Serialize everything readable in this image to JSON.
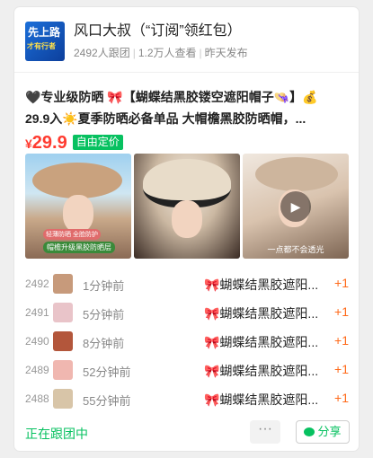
{
  "group": {
    "avatar_line1": "先上路",
    "avatar_line2": "才有行者",
    "avatar_line3": "",
    "name": "风口大叔（“订阅”领红包）",
    "members": "2492人跟团",
    "views": "1.2万人查看",
    "posted": "昨天发布"
  },
  "product": {
    "title_line1": "🖤专业级防晒 🎀【蝴蝶结黑胶镂空遮阳帽子👒】💰",
    "title_line2": "29.9入☀️夏季防晒必备单品 大帽檐黑胶防晒帽，...",
    "currency": "¥",
    "price": "29.9",
    "price_badge": "自由定价",
    "photo1_tag_top": "轻薄防晒 全脸防护",
    "photo1_tag": "帽檐升级黑胶防晒层",
    "photo3_caption": "一点都不会透光"
  },
  "orders": [
    {
      "num": "2492",
      "time": "1分钟前",
      "item": "🎀蝴蝶结黑胶遮阳...",
      "qty": "+1",
      "avatar_color": "#c79a7b"
    },
    {
      "num": "2491",
      "time": "5分钟前",
      "item": "🎀蝴蝶结黑胶遮阳...",
      "qty": "+1",
      "avatar_color": "#e9c4c9"
    },
    {
      "num": "2490",
      "time": "8分钟前",
      "item": "🎀蝴蝶结黑胶遮阳...",
      "qty": "+1",
      "avatar_color": "#b3563b"
    },
    {
      "num": "2489",
      "time": "52分钟前",
      "item": "🎀蝴蝶结黑胶遮阳...",
      "qty": "+1",
      "avatar_color": "#f0b7b0"
    },
    {
      "num": "2488",
      "time": "55分钟前",
      "item": "🎀蝴蝶结黑胶遮阳...",
      "qty": "+1",
      "avatar_color": "#d8c5a8"
    }
  ],
  "footer": {
    "status": "正在跟团中",
    "more": "···",
    "share": "分享"
  },
  "colors": {
    "accent": "#07c160",
    "price": "#ff3b30",
    "qty": "#ff6a1a"
  }
}
